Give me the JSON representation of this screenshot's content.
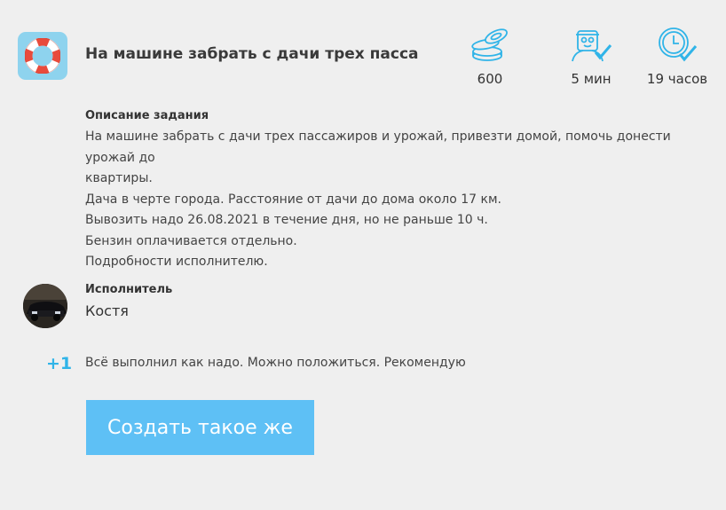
{
  "task": {
    "title": "На машине забрать с дачи трех пасса",
    "icon": "lifebuoy-icon"
  },
  "stats": {
    "price": "600",
    "response_time": "5 мин",
    "deadline": "19 часов"
  },
  "description": {
    "heading": "Описание задания",
    "lines": [
      "На машине забрать с дачи трех пассажиров и урожай, привезти домой, помочь донести урожай до",
      "квартиры.",
      "Дача в черте города. Расстояние от дачи до дома около 17 км.",
      "Вывозить надо 26.08.2021 в течение дня, но не раньше 10 ч.",
      "Бензин оплачивается отдельно.",
      "Подробности исполнителю."
    ]
  },
  "executor": {
    "label": "Исполнитель",
    "name": "Костя"
  },
  "review": {
    "rating": "+1",
    "text": "Всё выполнил как надо. Можно положиться. Рекомендую"
  },
  "actions": {
    "create_label": "Создать такое же"
  },
  "colors": {
    "accent": "#5ec0f5",
    "icon_blue": "#30b4e8",
    "task_icon_bg": "#8ed3ee",
    "background": "#efefef"
  }
}
